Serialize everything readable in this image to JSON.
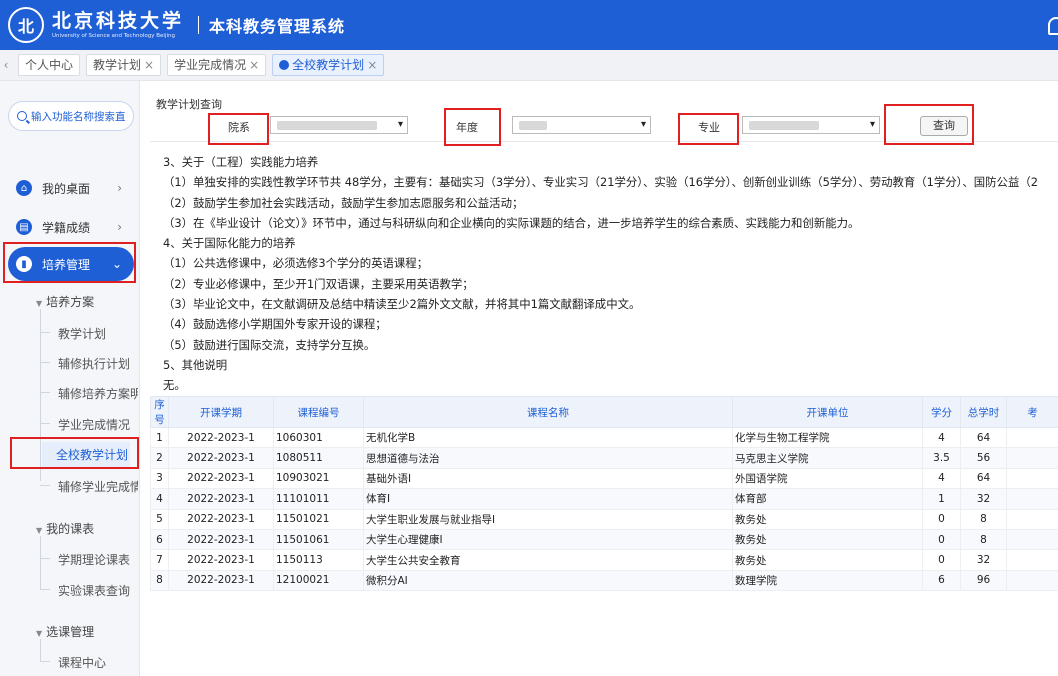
{
  "header": {
    "logo_glyph": "北",
    "school_cn": "北京科技大学",
    "school_en": "University of Science and Technology Beijing",
    "system_title": "本科教务管理系统"
  },
  "tabs": [
    {
      "label": "个人中心",
      "closable": false
    },
    {
      "label": "教学计划",
      "closable": true
    },
    {
      "label": "学业完成情况",
      "closable": true
    },
    {
      "label": "全校教学计划",
      "closable": true,
      "active": true
    }
  ],
  "tab_close_glyph": "×",
  "tab_prev_glyph": "‹",
  "sidebar": {
    "search_placeholder": "输入功能名称搜索直",
    "top_items": [
      {
        "label": "我的桌面",
        "icon": "home-icon",
        "glyph": "⌂"
      },
      {
        "label": "学籍成绩",
        "icon": "id-card-icon",
        "glyph": "▤"
      },
      {
        "label": "培养管理",
        "icon": "book-icon",
        "glyph": "▮",
        "active": true
      }
    ],
    "chev_right": "›",
    "chev_down": "⌄",
    "group_tri": "▼",
    "groups": [
      {
        "label": "培养方案",
        "items": [
          "教学计划",
          "辅修执行计划",
          "辅修培养方案明",
          "学业完成情况",
          "全校教学计划",
          "辅修学业完成情"
        ]
      },
      {
        "label": "我的课表",
        "items": [
          "学期理论课表",
          "实验课表查询"
        ]
      },
      {
        "label": "选课管理",
        "items": [
          "课程中心"
        ]
      }
    ]
  },
  "query": {
    "title": "教学计划查询",
    "department_label": "院系",
    "year_label": "年度",
    "major_label": "专业",
    "search_button": "查询"
  },
  "text_lines": [
    "3、关于（工程）实践能力培养",
    "（1）单独安排的实践性教学环节共 48学分，主要有：基础实习（3学分）、专业实习（21学分）、实验（16学分）、创新创业训练（5学分）、劳动教育（1学分）、国防公益（2",
    "（2）鼓励学生参加社会实践活动，鼓励学生参加志愿服务和公益活动；",
    "（3）在《毕业设计（论文）》环节中，通过与科研纵向和企业横向的实际课题的结合，进一步培养学生的综合素质、实践能力和创新能力。",
    "4、关于国际化能力的培养",
    "（1）公共选修课中，必须选修3个学分的英语课程；",
    "（2）专业必修课中，至少开1门双语课，主要采用英语教学；",
    "（3）毕业论文中，在文献调研及总结中精读至少2篇外文文献，并将其中1篇文献翻译成中文。",
    "（4）鼓励选修小学期国外专家开设的课程；",
    "（5）鼓励进行国际交流，支持学分互换。",
    "5、其他说明",
    "无。"
  ],
  "table": {
    "headers": [
      "序号",
      "开课学期",
      "课程编号",
      "课程名称",
      "开课单位",
      "学分",
      "总学时",
      "考"
    ],
    "rows": [
      [
        "1",
        "2022-2023-1",
        "1060301",
        "无机化学B",
        "化学与生物工程学院",
        "4",
        "64"
      ],
      [
        "2",
        "2022-2023-1",
        "1080511",
        "思想道德与法治",
        "马克思主义学院",
        "3.5",
        "56"
      ],
      [
        "3",
        "2022-2023-1",
        "10903021",
        "基础外语I",
        "外国语学院",
        "4",
        "64"
      ],
      [
        "4",
        "2022-2023-1",
        "11101011",
        "体育I",
        "体育部",
        "1",
        "32"
      ],
      [
        "5",
        "2022-2023-1",
        "11501021",
        "大学生职业发展与就业指导I",
        "教务处",
        "0",
        "8"
      ],
      [
        "6",
        "2022-2023-1",
        "11501061",
        "大学生心理健康I",
        "教务处",
        "0",
        "8"
      ],
      [
        "7",
        "2022-2023-1",
        "1150113",
        "大学生公共安全教育",
        "教务处",
        "0",
        "32"
      ],
      [
        "8",
        "2022-2023-1",
        "12100021",
        "微积分AI",
        "数理学院",
        "6",
        "96"
      ]
    ]
  },
  "colors": {
    "brand": "#1f5fd6",
    "highlight": "#e02020"
  }
}
